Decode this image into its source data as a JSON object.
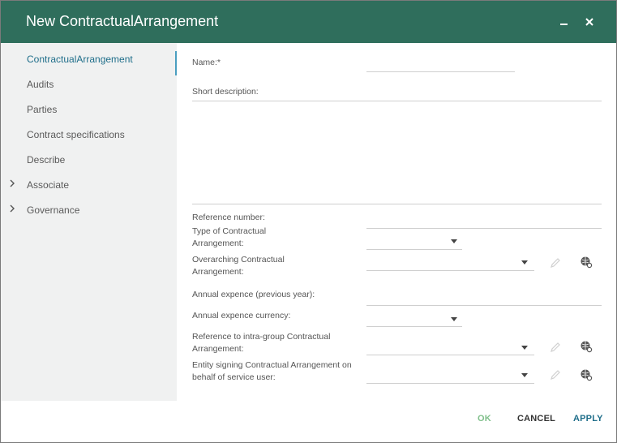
{
  "window": {
    "title": "New ContractualArrangement",
    "minimize_icon": "minimize-icon",
    "close_icon": "close-icon"
  },
  "sidebar": {
    "items": [
      {
        "label": "ContractualArrangement",
        "active": true,
        "expandable": false
      },
      {
        "label": "Audits",
        "active": false,
        "expandable": false
      },
      {
        "label": "Parties",
        "active": false,
        "expandable": false
      },
      {
        "label": "Contract specifications",
        "active": false,
        "expandable": false
      },
      {
        "label": "Describe",
        "active": false,
        "expandable": false
      },
      {
        "label": "Associate",
        "active": false,
        "expandable": true
      },
      {
        "label": "Governance",
        "active": false,
        "expandable": true
      }
    ]
  },
  "form": {
    "name_label": "Name:*",
    "name_value": "",
    "short_description_label": "Short description:",
    "short_description_value": "",
    "reference_number_label": "Reference number:",
    "type_label_1": "Type of Contractual",
    "type_label_2": "Arrangement:",
    "overarching_label_1": "Overarching Contractual",
    "overarching_label_2": "Arrangement:",
    "annual_expence_label": "Annual expence (previous year):",
    "annual_currency_label": "Annual expence currency:",
    "intra_group_label_1": "Reference to intra-group Contractual",
    "intra_group_label_2": "Arrangement:",
    "entity_signing_label_1": "Entity signing Contractual Arrangement on",
    "entity_signing_label_2": "behalf of service user:",
    "icons": {
      "edit": "pencil-icon",
      "globe_link": "globe-link-icon"
    }
  },
  "footer": {
    "ok_label": "OK",
    "cancel_label": "CANCEL",
    "apply_label": "APPLY"
  },
  "colors": {
    "titlebar": "#2f6e5c",
    "sidebar_bg": "#f0f1f1",
    "active_nav": "#1f6e8a",
    "ok_disabled": "#7fbf8a",
    "apply": "#1f6e8a"
  }
}
